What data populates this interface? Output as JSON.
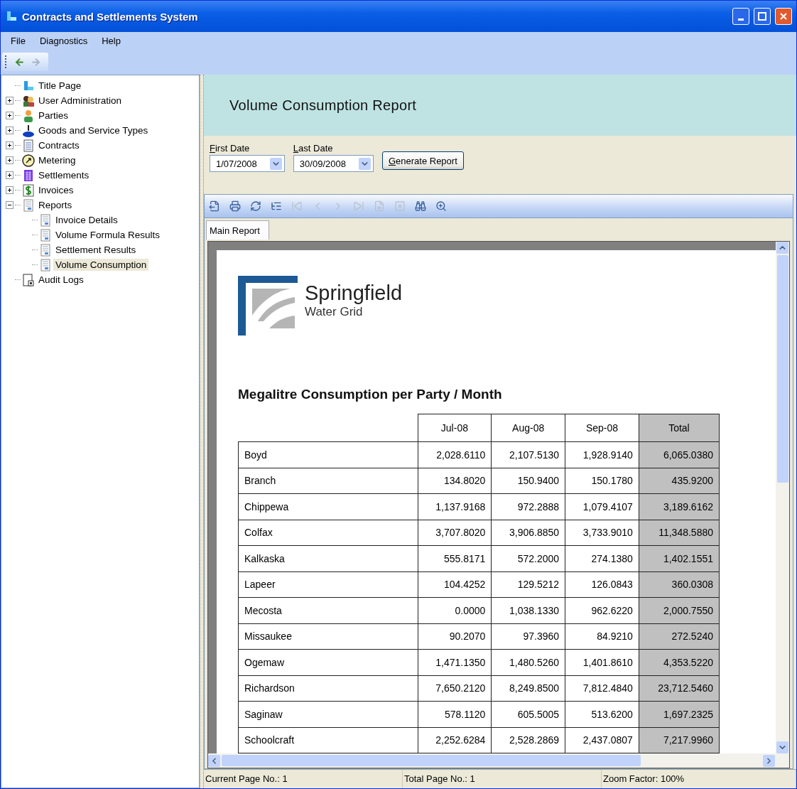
{
  "window": {
    "title": "Contracts and Settlements System"
  },
  "menu": [
    "File",
    "Diagnostics",
    "Help"
  ],
  "nav_toolbar": [
    {
      "kind": "back",
      "disabled": false
    },
    {
      "kind": "forward",
      "disabled": true
    }
  ],
  "tree": [
    {
      "label": "Title Page",
      "kind": "title",
      "selected": false
    },
    {
      "label": "User Administration",
      "kind": "users",
      "expanded": false,
      "selected": false
    },
    {
      "label": "Parties",
      "kind": "person",
      "expanded": false,
      "selected": false
    },
    {
      "label": "Goods and Service Types",
      "kind": "goods",
      "expanded": false,
      "selected": false
    },
    {
      "label": "Contracts",
      "kind": "document",
      "expanded": false,
      "selected": false
    },
    {
      "label": "Metering",
      "kind": "meter",
      "expanded": false,
      "selected": false
    },
    {
      "label": "Settlements",
      "kind": "calendar",
      "expanded": false,
      "selected": false
    },
    {
      "label": "Invoices",
      "kind": "dollar",
      "expanded": false,
      "selected": false
    },
    {
      "label": "Reports",
      "kind": "report",
      "expanded": true,
      "selected": false,
      "children": [
        {
          "label": "Invoice Details",
          "kind": "report",
          "selected": false
        },
        {
          "label": "Volume Formula Results",
          "kind": "report",
          "selected": false
        },
        {
          "label": "Settlement Results",
          "kind": "report",
          "selected": false
        },
        {
          "label": "Volume Consumption",
          "kind": "report",
          "selected": true
        }
      ]
    },
    {
      "label": "Audit Logs",
      "kind": "log",
      "selected": false
    }
  ],
  "page_title": "Volume Consumption Report",
  "filters": [
    {
      "label": "First Date",
      "value": "1/07/2008"
    },
    {
      "label": "Last Date",
      "value": "30/09/2008"
    }
  ],
  "generate_button": "Generate Report",
  "viewer_toolbar": [
    {
      "kind": "export",
      "disabled": false
    },
    {
      "kind": "print",
      "disabled": false
    },
    {
      "kind": "refresh",
      "disabled": false
    },
    {
      "kind": "group-tree",
      "disabled": false
    },
    {
      "kind": "first",
      "disabled": true
    },
    {
      "kind": "previous",
      "disabled": true
    },
    {
      "kind": "next",
      "disabled": true
    },
    {
      "kind": "last",
      "disabled": true
    },
    {
      "kind": "goto",
      "disabled": true
    },
    {
      "kind": "stop",
      "disabled": true
    },
    {
      "kind": "search",
      "disabled": false
    },
    {
      "kind": "zoom",
      "disabled": false
    }
  ],
  "report_tabs": [
    {
      "label": "Main Report",
      "selected": true
    }
  ],
  "report": {
    "logo_name": "Springfield",
    "logo_subtitle": "Water Grid",
    "table_title": "Megalitre Consumption per Party / Month",
    "columns": [
      "Jul-08",
      "Aug-08",
      "Sep-08",
      "Total"
    ],
    "rows": [
      {
        "party": "Boyd",
        "values": [
          "2,028.6110",
          "2,107.5130",
          "1,928.9140",
          "6,065.0380"
        ]
      },
      {
        "party": "Branch",
        "values": [
          "134.8020",
          "150.9400",
          "150.1780",
          "435.9200"
        ]
      },
      {
        "party": "Chippewa",
        "values": [
          "1,137.9168",
          "972.2888",
          "1,079.4107",
          "3,189.6162"
        ]
      },
      {
        "party": "Colfax",
        "values": [
          "3,707.8020",
          "3,906.8850",
          "3,733.9010",
          "11,348.5880"
        ]
      },
      {
        "party": "Kalkaska",
        "values": [
          "555.8171",
          "572.2000",
          "274.1380",
          "1,402.1551"
        ]
      },
      {
        "party": "Lapeer",
        "values": [
          "104.4252",
          "129.5212",
          "126.0843",
          "360.0308"
        ]
      },
      {
        "party": "Mecosta",
        "values": [
          "0.0000",
          "1,038.1330",
          "962.6220",
          "2,000.7550"
        ]
      },
      {
        "party": "Missaukee",
        "values": [
          "90.2070",
          "97.3960",
          "84.9210",
          "272.5240"
        ]
      },
      {
        "party": "Ogemaw",
        "values": [
          "1,471.1350",
          "1,480.5260",
          "1,401.8610",
          "4,353.5220"
        ]
      },
      {
        "party": "Richardson",
        "values": [
          "7,650.2120",
          "8,249.8500",
          "7,812.4840",
          "23,712.5460"
        ]
      },
      {
        "party": "Saginaw",
        "values": [
          "578.1120",
          "605.5005",
          "513.6200",
          "1,697.2325"
        ]
      },
      {
        "party": "Schoolcraft",
        "values": [
          "2,252.6284",
          "2,528.2869",
          "2,437.0807",
          "7,217.9960"
        ]
      }
    ]
  },
  "status_bar": [
    "Current Page No.: 1",
    "Total Page No.: 1",
    "Zoom Factor: 100%"
  ]
}
